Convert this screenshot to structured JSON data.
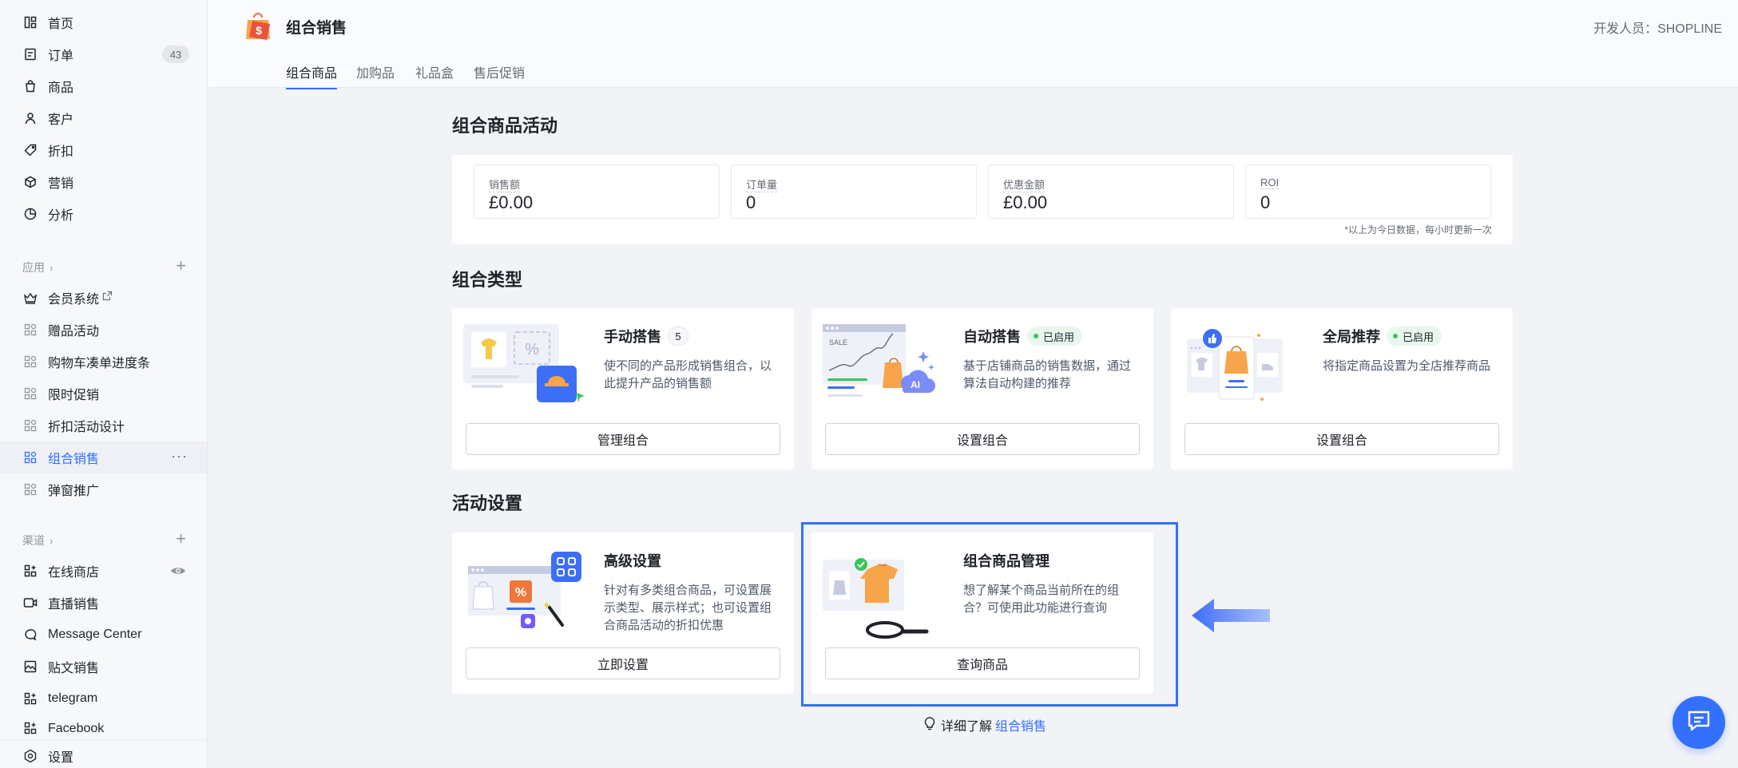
{
  "sidebar": {
    "items": [
      {
        "label": "首页",
        "icon": "dashboard-icon"
      },
      {
        "label": "订单",
        "icon": "order-icon",
        "badge": "43"
      },
      {
        "label": "商品",
        "icon": "bag-icon"
      },
      {
        "label": "客户",
        "icon": "user-icon"
      },
      {
        "label": "折扣",
        "icon": "tag-icon"
      },
      {
        "label": "营销",
        "icon": "cube-icon"
      },
      {
        "label": "分析",
        "icon": "pie-icon"
      }
    ],
    "apps_header": "应用",
    "apps": [
      {
        "label": "会员系统",
        "icon": "crown-icon",
        "external": true
      },
      {
        "label": "赠品活动",
        "icon": "app-grid-icon"
      },
      {
        "label": "购物车凑单进度条",
        "icon": "app-grid-icon"
      },
      {
        "label": "限时促销",
        "icon": "app-grid-icon"
      },
      {
        "label": "折扣活动设计",
        "icon": "app-grid-icon"
      },
      {
        "label": "组合销售",
        "icon": "app-grid-icon",
        "active": true
      },
      {
        "label": "弹窗推广",
        "icon": "app-grid-icon"
      }
    ],
    "channels_header": "渠道",
    "channels": [
      {
        "label": "在线商店",
        "icon": "store-icon"
      },
      {
        "label": "直播销售",
        "icon": "video-icon"
      },
      {
        "label": "Message Center",
        "icon": "message-icon"
      },
      {
        "label": "贴文销售",
        "icon": "image-icon"
      },
      {
        "label": "telegram",
        "icon": "app-grid-icon"
      },
      {
        "label": "Facebook",
        "icon": "app-grid-icon"
      }
    ],
    "settings": "设置"
  },
  "header": {
    "title": "组合销售",
    "developer": "开发人员：SHOPLINE",
    "tabs": [
      "组合商品",
      "加购品",
      "礼品盒",
      "售后促销"
    ]
  },
  "activity": {
    "title": "组合商品活动",
    "stats": [
      {
        "label": "销售额",
        "value": "£0.00"
      },
      {
        "label": "订单量",
        "value": "0"
      },
      {
        "label": "优惠金额",
        "value": "£0.00"
      },
      {
        "label": "ROI",
        "value": "0"
      }
    ],
    "note": "*以上为今日数据，每小时更新一次"
  },
  "types": {
    "title": "组合类型",
    "cards": [
      {
        "title": "手动搭售",
        "count": "5",
        "desc": "使不同的产品形成销售组合，以此提升产品的销售额",
        "button": "管理组合"
      },
      {
        "title": "自动搭售",
        "status": "已启用",
        "desc": "基于店铺商品的销售数据，通过算法自动构建的推荐",
        "button": "设置组合",
        "illus_text": "SALE",
        "ai_text": "AI"
      },
      {
        "title": "全局推荐",
        "status": "已启用",
        "desc": "将指定商品设置为全店推荐商品",
        "button": "设置组合"
      }
    ]
  },
  "settings_section": {
    "title": "活动设置",
    "cards": [
      {
        "title": "高级设置",
        "desc": "针对有多类组合商品，可设置展示类型、展示样式；也可设置组合商品活动的折扣优惠",
        "button": "立即设置"
      },
      {
        "title": "组合商品管理",
        "desc": "想了解某个商品当前所在的组合？可使用此功能进行查询",
        "button": "查询商品"
      }
    ]
  },
  "learn_more": {
    "prefix": "详细了解",
    "link": "组合销售"
  },
  "colors": {
    "accent": "#3370ff",
    "enabled": "#34c759"
  }
}
